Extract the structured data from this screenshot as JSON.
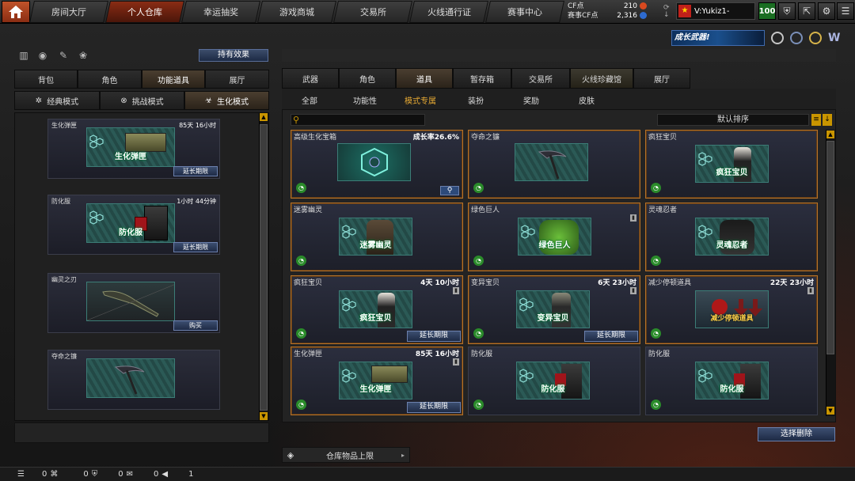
{
  "top_nav": {
    "tabs": [
      {
        "label": "房间大厅"
      },
      {
        "label": "个人仓库"
      },
      {
        "label": "幸运抽奖"
      },
      {
        "label": "游戏商城"
      },
      {
        "label": "交易所"
      },
      {
        "label": "火线通行证"
      },
      {
        "label": "赛事中心"
      }
    ],
    "active_tab": "个人仓库"
  },
  "currency": {
    "cf_label": "CF点",
    "cf_value": "210",
    "event_cf_label": "赛事CF点",
    "event_cf_value": "2,316"
  },
  "user": {
    "name": "V:Yukiz1-",
    "level": "100"
  },
  "promo": {
    "text": "成长武器!"
  },
  "left": {
    "hold_effect_button": "持有效果",
    "tabs": [
      "背包",
      "角色",
      "功能道具",
      "展厅"
    ],
    "active_tab": "功能道具",
    "mode_tabs": [
      "经典模式",
      "挑战模式",
      "生化模式"
    ],
    "active_mode": "生化模式",
    "items": [
      {
        "name": "生化弹匣",
        "time": "85天 16小时",
        "art_label": "生化弹匣",
        "action": "延长期限"
      },
      {
        "name": "防化服",
        "time": "1小时 44分钟",
        "art_label": "防化服",
        "action": "延长期限"
      },
      {
        "name": "幽灵之刃",
        "time": "",
        "art_label": "",
        "action": "购买"
      },
      {
        "name": "夺命之镰",
        "time": "",
        "art_label": "",
        "action": ""
      }
    ]
  },
  "right": {
    "tabs": [
      "武器",
      "角色",
      "道具",
      "暂存箱",
      "交易所",
      "火线珍藏馆",
      "展厅"
    ],
    "active_tab": "道具",
    "filters": [
      "全部",
      "功能性",
      "模式专属",
      "装扮",
      "奖励",
      "皮肤"
    ],
    "active_filter": "模式专属",
    "search_placeholder": "",
    "sort_label": "默认排序",
    "items": [
      {
        "name": "高级生化宝箱",
        "time": "成长率26.6%",
        "art_label": "",
        "action": "",
        "rare": true
      },
      {
        "name": "夺命之镰",
        "time": "",
        "art_label": "",
        "action": "",
        "rare": true
      },
      {
        "name": "疯狂宝贝",
        "time": "",
        "art_label": "疯狂宝贝",
        "action": "",
        "rare": true
      },
      {
        "name": "迷雾幽灵",
        "time": "",
        "art_label": "迷雾幽灵",
        "action": "",
        "rare": true
      },
      {
        "name": "绿色巨人",
        "time": "",
        "art_label": "绿色巨人",
        "action": "",
        "rare": true
      },
      {
        "name": "灵魂忍者",
        "time": "",
        "art_label": "灵魂忍者",
        "action": "",
        "rare": true
      },
      {
        "name": "疯狂宝贝",
        "time": "4天 10小时",
        "art_label": "疯狂宝贝",
        "action": "延长期限",
        "rare": true
      },
      {
        "name": "变异宝贝",
        "time": "6天 23小时",
        "art_label": "变异宝贝",
        "action": "延长期限",
        "rare": true
      },
      {
        "name": "减少停顿道具",
        "time": "22天 23小时",
        "art_label": "减少停顿道具",
        "action": "",
        "rare": true
      },
      {
        "name": "生化弹匣",
        "time": "85天 16小时",
        "art_label": "生化弹匣",
        "action": "延长期限",
        "rare": true
      },
      {
        "name": "防化服",
        "time": "",
        "art_label": "防化服",
        "action": "",
        "rare": false
      },
      {
        "name": "防化服",
        "time": "",
        "art_label": "防化服",
        "action": "",
        "rare": false
      }
    ],
    "select_delete_button": "选择删除",
    "storage_limit_label": "仓库物品上限"
  },
  "bottom_bar": {
    "counts": [
      "0",
      "0",
      "0",
      "0",
      "1"
    ]
  },
  "colors": {
    "accent_orange": "#b5722a",
    "active_tab_red": "#8a2c14",
    "button_blue": "#3c4e70",
    "level_green": "#1a6e22"
  }
}
